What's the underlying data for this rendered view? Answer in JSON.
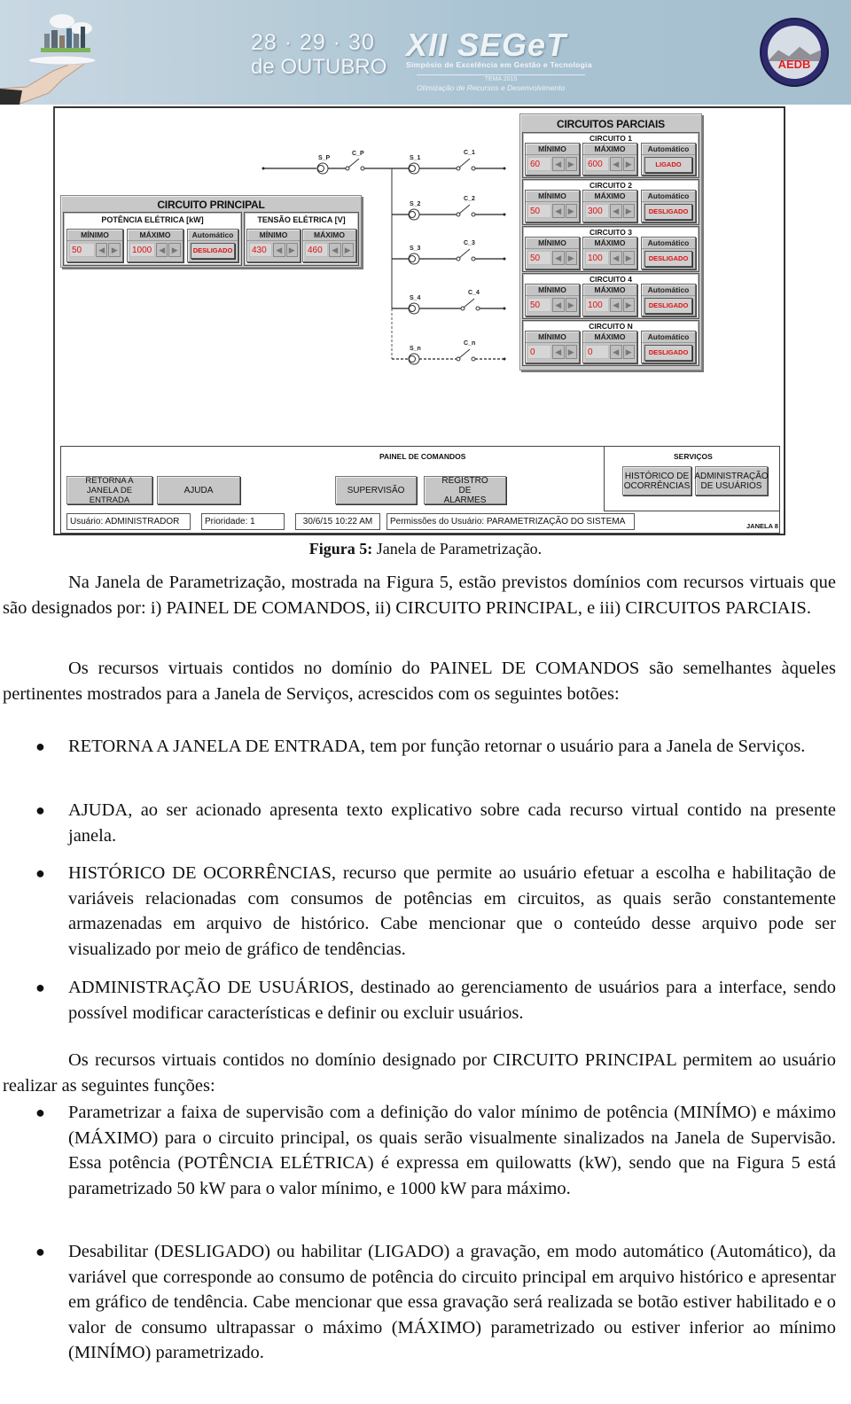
{
  "banner": {
    "dates": "28 · 29 · 30",
    "month": "de OUTUBRO",
    "event_name": "XII SEGeT",
    "event_subtitle": "Simpósio de Excelência em Gestão e Tecnologia",
    "theme_label": "TEMA 2015",
    "theme": "Otimização de Recursos e Desenvolvimento",
    "logo_text": "AEDB"
  },
  "figure": {
    "circuito_principal": {
      "title": "CIRCUITO PRINCIPAL",
      "potencia": {
        "title": "POTÊNCIA  ELÉTRICA  [kW]",
        "min_label": "MÍNIMO",
        "min_value": "50",
        "max_label": "MÁXIMO",
        "max_value": "1000",
        "auto_label": "Automático",
        "auto_state": "DESLIGADO"
      },
      "tensao": {
        "title": "TENSÃO ELÉTRICA [V]",
        "min_label": "MÍNIMO",
        "min_value": "430",
        "max_label": "MÁXIMO",
        "max_value": "460"
      }
    },
    "circuitos_parciais": {
      "title": "CIRCUITOS PARCIAIS",
      "min_label": "MÍNIMO",
      "max_label": "MÁXIMO",
      "auto_label": "Automático",
      "circuits": [
        {
          "name": "CIRCUITO 1",
          "min": "60",
          "max": "600",
          "state": "LIGADO"
        },
        {
          "name": "CIRCUITO 2",
          "min": "50",
          "max": "300",
          "state": "DESLIGADO"
        },
        {
          "name": "CIRCUITO 3",
          "min": "50",
          "max": "100",
          "state": "DESLIGADO"
        },
        {
          "name": "CIRCUITO 4",
          "min": "50",
          "max": "100",
          "state": "DESLIGADO"
        },
        {
          "name": "CIRCUITO N",
          "min": "0",
          "max": "0",
          "state": "DESLIGADO"
        }
      ]
    },
    "schematic": {
      "main": {
        "sensor": "S_P",
        "switch": "C_P"
      },
      "branches": [
        {
          "sensor": "S_1",
          "switch": "C_1"
        },
        {
          "sensor": "S_2",
          "switch": "C_2"
        },
        {
          "sensor": "S_3",
          "switch": "C_3"
        },
        {
          "sensor": "S_4",
          "switch": "C_4"
        },
        {
          "sensor": "S_n",
          "switch": "C_n"
        }
      ]
    },
    "painel": {
      "title": "PAINEL DE COMANDOS",
      "buttons": {
        "retorna": "RETORNA A JANELA DE ENTRADA",
        "ajuda": "AJUDA",
        "supervisao": "SUPERVISÃO",
        "registro": "REGISTRO DE ALARMES"
      },
      "services_title": "SERVIÇOS",
      "services": {
        "historico": "HISTÓRICO DE OCORRÊNCIAS",
        "admin": "ADMINISTRAÇÃO DE USUÁRIOS"
      },
      "status": {
        "usuario": "Usuário: ADMINISTRADOR",
        "prioridade": "Prioridade: 1",
        "datetime": "30/6/15 10:22 AM",
        "permissoes": "Permissões do Usuário: PARAMETRIZAÇÃO DO SISTEMA",
        "janela": "JANELA 8"
      }
    }
  },
  "caption": {
    "label": "Figura 5:",
    "text": " Janela de Parametrização."
  },
  "text": {
    "p1": "Na Janela de Parametrização, mostrada na Figura 5, estão previstos domínios com recursos virtuais que são designados por: i) PAINEL DE COMANDOS, ii) CIRCUITO PRINCIPAL, e iii) CIRCUITOS PARCIAIS.",
    "p2": "Os recursos virtuais contidos no domínio do PAINEL DE COMANDOS são semelhantes àqueles pertinentes mostrados para a Janela de Serviços, acrescidos com os seguintes botões:",
    "bullets1": [
      "RETORNA A JANELA DE ENTRADA, tem por função retornar o usuário para a Janela de Serviços.",
      "AJUDA, ao ser acionado apresenta texto explicativo sobre cada recurso virtual contido na presente janela.",
      "HISTÓRICO DE OCORRÊNCIAS, recurso que permite ao usuário efetuar a escolha e habilitação de variáveis relacionadas com consumos de potências em circuitos, as quais serão constantemente armazenadas em arquivo de histórico. Cabe mencionar que o conteúdo desse arquivo pode ser visualizado por meio de gráfico de tendências.",
      "ADMINISTRAÇÃO DE USUÁRIOS, destinado ao gerenciamento de usuários para a interface, sendo possível modificar características e definir ou excluir usuários."
    ],
    "p3": "Os recursos virtuais contidos no domínio designado por CIRCUITO PRINCIPAL permitem ao usuário realizar as seguintes funções:",
    "bullets2": [
      "Parametrizar a faixa de supervisão com a definição do valor mínimo de potência (MINÍMO) e máximo (MÁXIMO) para o circuito principal, os quais serão visualmente sinalizados na Janela de Supervisão. Essa potência (POTÊNCIA ELÉTRICA) é expressa em quilowatts (kW), sendo que na Figura 5 está parametrizado 50 kW para o valor mínimo, e 1000 kW para máximo.",
      "Desabilitar (DESLIGADO) ou habilitar (LIGADO) a gravação, em modo automático (Automático), da variável que corresponde ao consumo de potência do circuito principal em arquivo histórico e apresentar em gráfico de tendência. Cabe mencionar que essa gravação será realizada se botão estiver habilitado e o valor de consumo ultrapassar o máximo (MÁXIMO) parametrizado ou estiver inferior ao mínimo (MINÍMO) parametrizado."
    ]
  }
}
